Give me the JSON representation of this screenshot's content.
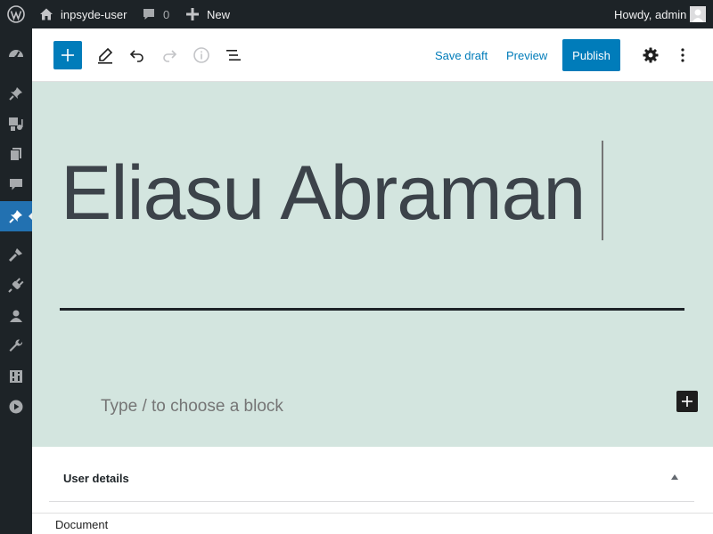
{
  "admin_bar": {
    "site_name": "inpsyde-user",
    "comment_count": "0",
    "new_label": "New",
    "howdy": "Howdy, admin"
  },
  "sidebar": {
    "items": [
      {
        "icon": "dashboard-icon"
      },
      {
        "icon": "pin-icon"
      },
      {
        "icon": "media-icon"
      },
      {
        "icon": "pages-icon"
      },
      {
        "icon": "comments-icon"
      },
      {
        "icon": "pin-icon",
        "active": true
      },
      {
        "icon": "appearance-icon"
      },
      {
        "icon": "plugins-icon"
      },
      {
        "icon": "users-icon"
      },
      {
        "icon": "tools-icon"
      },
      {
        "icon": "settings-icon"
      },
      {
        "icon": "play-icon"
      }
    ]
  },
  "toolbar": {
    "save_draft": "Save draft",
    "preview": "Preview",
    "publish": "Publish"
  },
  "editor": {
    "title": "Eliasu Abraman",
    "block_placeholder": "Type / to choose a block"
  },
  "metabox": {
    "title": "User details"
  },
  "footer": {
    "label": "Document"
  },
  "colors": {
    "admin_bar_bg": "#1d2327",
    "accent": "#007cba",
    "canvas_bg": "#d3e5df",
    "title_text": "#3c434a"
  }
}
